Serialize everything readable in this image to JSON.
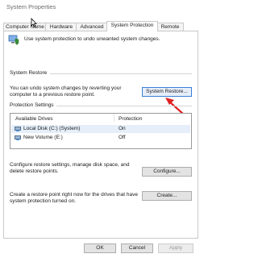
{
  "window": {
    "title": "System Properties"
  },
  "tabs": [
    {
      "label": "Computer Name"
    },
    {
      "label": "Hardware"
    },
    {
      "label": "Advanced"
    },
    {
      "label": "System Protection",
      "active": true
    },
    {
      "label": "Remote"
    }
  ],
  "intro": {
    "text": "Use system protection to undo unwanted system changes."
  },
  "system_restore": {
    "heading": "System Restore",
    "description": "You can undo system changes by reverting your computer to a previous restore point.",
    "button_label": "System Restore..."
  },
  "protection": {
    "heading": "Protection Settings",
    "columns": [
      "Available Drives",
      "Protection"
    ],
    "rows": [
      {
        "drive": "Local Disk (C:) (System)",
        "status": "On"
      },
      {
        "drive": "New Volume (E:)",
        "status": "Off"
      }
    ]
  },
  "configure": {
    "description": "Configure restore settings, manage disk space, and delete restore points.",
    "button_label": "Configure..."
  },
  "create": {
    "description": "Create a restore point right now for the drives that have system protection turned on.",
    "button_label": "Create..."
  },
  "footer": {
    "ok": "OK",
    "cancel": "Cancel",
    "apply": "Apply"
  },
  "colors": {
    "annotation_arrow": "#e02020",
    "focus_border": "#3c7fd6"
  }
}
